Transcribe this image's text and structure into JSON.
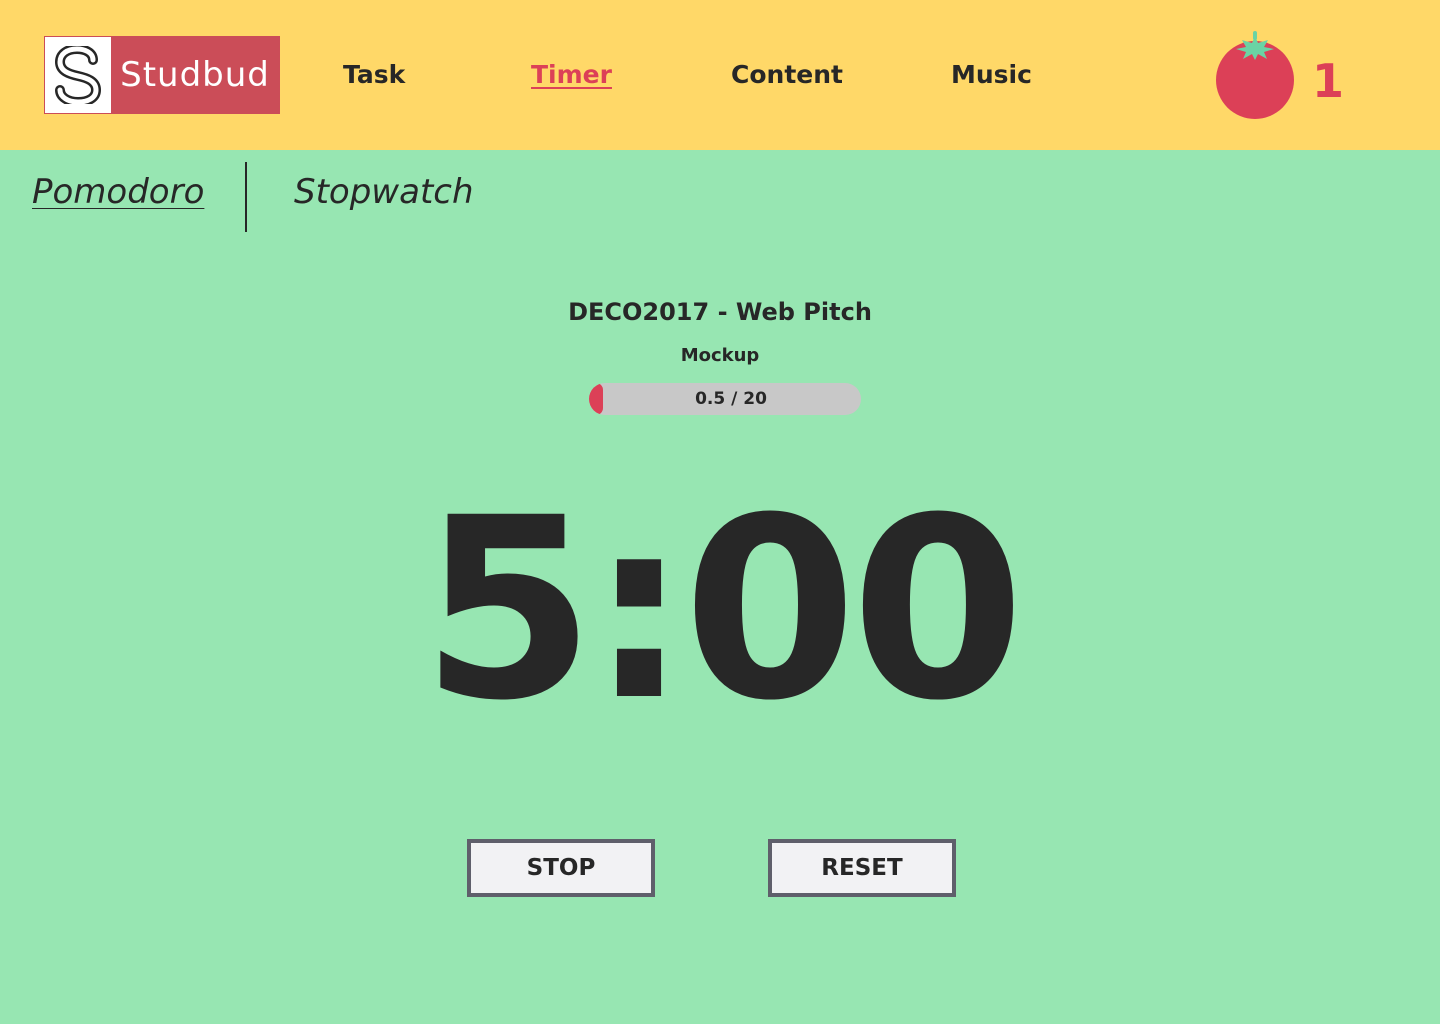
{
  "header": {
    "logo": {
      "text": "Studbud"
    },
    "nav": [
      {
        "label": "Task",
        "active": false
      },
      {
        "label": "Timer",
        "active": true
      },
      {
        "label": "Content",
        "active": false
      },
      {
        "label": "Music",
        "active": false
      }
    ],
    "pomodoro_count": "1"
  },
  "timer_tabs": [
    {
      "label": "Pomodoro",
      "active": true
    },
    {
      "label": "Stopwatch",
      "active": false
    }
  ],
  "task": {
    "title": "DECO2017 - Web Pitch",
    "subtitle": "Mockup",
    "progress": {
      "label": "0.5 / 20",
      "fraction": 0.025
    }
  },
  "timer": {
    "display": "5:00"
  },
  "buttons": {
    "stop": "STOP",
    "reset": "RESET"
  },
  "colors": {
    "header_bg": "#ffd868",
    "page_bg": "#97e6b2",
    "accent": "#dc4057",
    "logo_bg": "#cb4d58",
    "text": "#272727",
    "progress_track": "#c8c8c8"
  },
  "icons": {
    "logo": "studbud-s-icon",
    "pomodoro": "tomato-icon"
  }
}
